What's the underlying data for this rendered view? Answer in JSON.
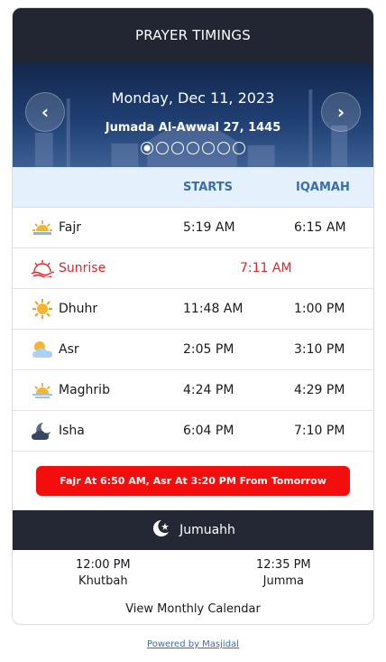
{
  "header": {
    "title": "PRAYER TIMINGS"
  },
  "banner": {
    "date": "Monday, Dec 11, 2023",
    "hijri": "Jumada Al-Awwal 27, 1445",
    "prev_label": "‹",
    "next_label": "›",
    "dot_count": 7,
    "active_dot": 0
  },
  "columns": {
    "starts": "STARTS",
    "iqamah": "IQAMAH"
  },
  "prayers": [
    {
      "name": "Fajr",
      "starts": "5:19 AM",
      "iqamah": "6:15 AM",
      "icon": "sunrise-horizon-icon"
    },
    {
      "name": "Sunrise",
      "starts": "7:11 AM",
      "iqamah": "",
      "icon": "sunrise-icon",
      "highlight_color": "#e0262d"
    },
    {
      "name": "Dhuhr",
      "starts": "11:48 AM",
      "iqamah": "1:00 PM",
      "icon": "sun-icon"
    },
    {
      "name": "Asr",
      "starts": "2:05 PM",
      "iqamah": "3:10 PM",
      "icon": "sun-cloud-icon"
    },
    {
      "name": "Maghrib",
      "starts": "4:24 PM",
      "iqamah": "4:29 PM",
      "icon": "sunset-icon"
    },
    {
      "name": "Isha",
      "starts": "6:04 PM",
      "iqamah": "7:10 PM",
      "icon": "moon-cloud-icon"
    }
  ],
  "notice": {
    "text": "Fajr At 6:50 AM, Asr At 3:20 PM From Tomorrow",
    "color": "#f40d0d"
  },
  "jumuah": {
    "title": "Jumuahh",
    "icon": "crescent-star-icon",
    "times": [
      {
        "time": "12:00 PM",
        "label": "Khutbah"
      },
      {
        "time": "12:35 PM",
        "label": "Jumma"
      }
    ]
  },
  "links": {
    "monthly": "View Monthly Calendar",
    "powered": "Powered by Masjidal"
  },
  "colors": {
    "header_bg": "#212632",
    "accent_blue": "#3a6ea8",
    "alert_red": "#f40d0d"
  }
}
